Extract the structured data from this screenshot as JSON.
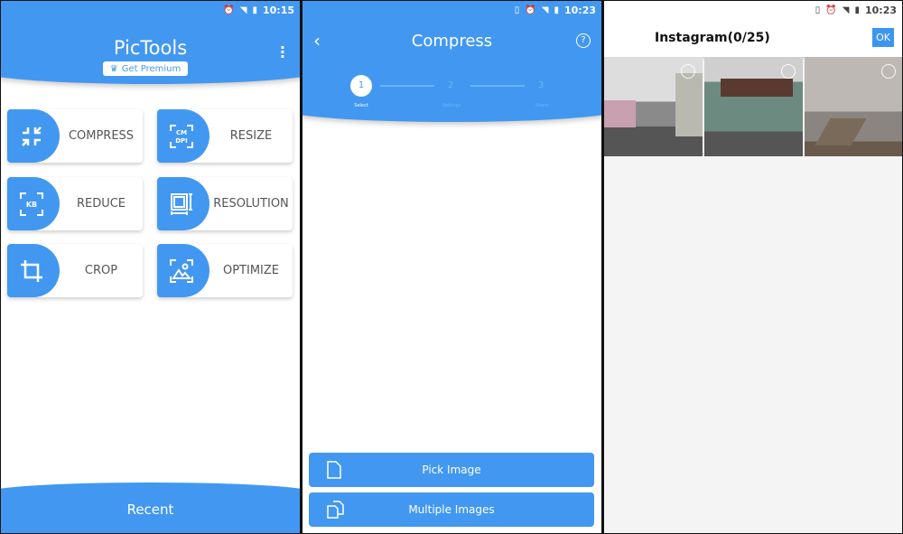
{
  "colors": {
    "accent": "#4298f0"
  },
  "home": {
    "status": {
      "time": "10:15",
      "icons": [
        "alarm-icon",
        "wifi-icon",
        "signal-icon",
        "battery-icon"
      ]
    },
    "title": "PicTools",
    "premium_label": "Get Premium",
    "tools": [
      {
        "label": "COMPRESS",
        "icon": "compress-icon"
      },
      {
        "label": "RESIZE",
        "icon": "cm-dpi-icon"
      },
      {
        "label": "REDUCE",
        "icon": "kb-icon"
      },
      {
        "label": "RESOLUTION",
        "icon": "resolution-icon"
      },
      {
        "label": "CROP",
        "icon": "crop-icon"
      },
      {
        "label": "OPTIMIZE",
        "icon": "optimize-image-icon"
      }
    ],
    "cm": "CM",
    "dpi": "DPI",
    "kb": "KB",
    "recent_label": "Recent"
  },
  "compress": {
    "status": {
      "time": "10:23"
    },
    "title": "Compress",
    "steps": [
      {
        "num": "1",
        "label": "Select",
        "active": true
      },
      {
        "num": "2",
        "label": "Settings",
        "active": false
      },
      {
        "num": "3",
        "label": "Share",
        "active": false
      }
    ],
    "pick_label": "Pick Image",
    "multiple_label": "Multiple Images"
  },
  "picker": {
    "status": {
      "time": "10:23"
    },
    "title": "Instagram(0/25)",
    "ok_label": "OK",
    "selected": 0,
    "max": 25
  }
}
